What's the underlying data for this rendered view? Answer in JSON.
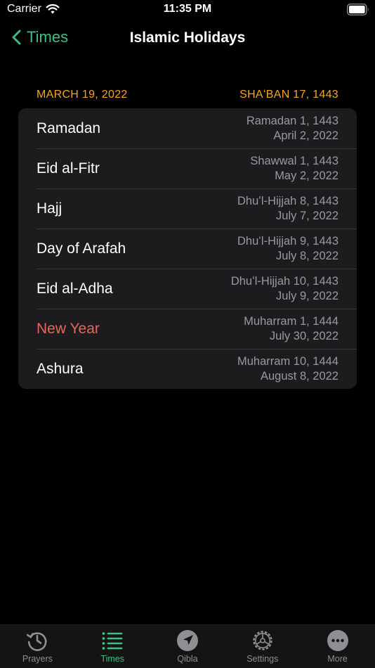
{
  "status_bar": {
    "carrier": "Carrier",
    "time": "11:35 PM"
  },
  "nav": {
    "back_label": "Times",
    "title": "Islamic Holidays"
  },
  "section": {
    "gregorian_date": "MARCH 19, 2022",
    "hijri_date": "SHAʻBAN 17, 1443"
  },
  "holidays": [
    {
      "name": "Ramadan",
      "hijri": "Ramadan 1, 1443",
      "gregorian": "April 2, 2022",
      "highlight": false
    },
    {
      "name": "Eid al-Fitr",
      "hijri": "Shawwal 1, 1443",
      "gregorian": "May 2, 2022",
      "highlight": false
    },
    {
      "name": "Hajj",
      "hijri": "Dhuʻl-Hijjah 8, 1443",
      "gregorian": "July 7, 2022",
      "highlight": false
    },
    {
      "name": "Day of Arafah",
      "hijri": "Dhuʻl-Hijjah 9, 1443",
      "gregorian": "July 8, 2022",
      "highlight": false
    },
    {
      "name": "Eid al-Adha",
      "hijri": "Dhuʻl-Hijjah 10, 1443",
      "gregorian": "July 9, 2022",
      "highlight": false
    },
    {
      "name": "New Year",
      "hijri": "Muharram 1, 1444",
      "gregorian": "July 30, 2022",
      "highlight": true
    },
    {
      "name": "Ashura",
      "hijri": "Muharram 10, 1444",
      "gregorian": "August 8, 2022",
      "highlight": false
    }
  ],
  "tabs": [
    {
      "label": "Prayers",
      "icon": "history-icon",
      "active": false
    },
    {
      "label": "Times",
      "icon": "list-icon",
      "active": true
    },
    {
      "label": "Qibla",
      "icon": "location-arrow-icon",
      "active": false
    },
    {
      "label": "Settings",
      "icon": "gear-icon",
      "active": false
    },
    {
      "label": "More",
      "icon": "ellipsis-icon",
      "active": false
    }
  ],
  "colors": {
    "accent": "#3fbf7f",
    "header": "#f5a623",
    "highlight": "#e8665a",
    "inactive": "#8e8e93"
  }
}
